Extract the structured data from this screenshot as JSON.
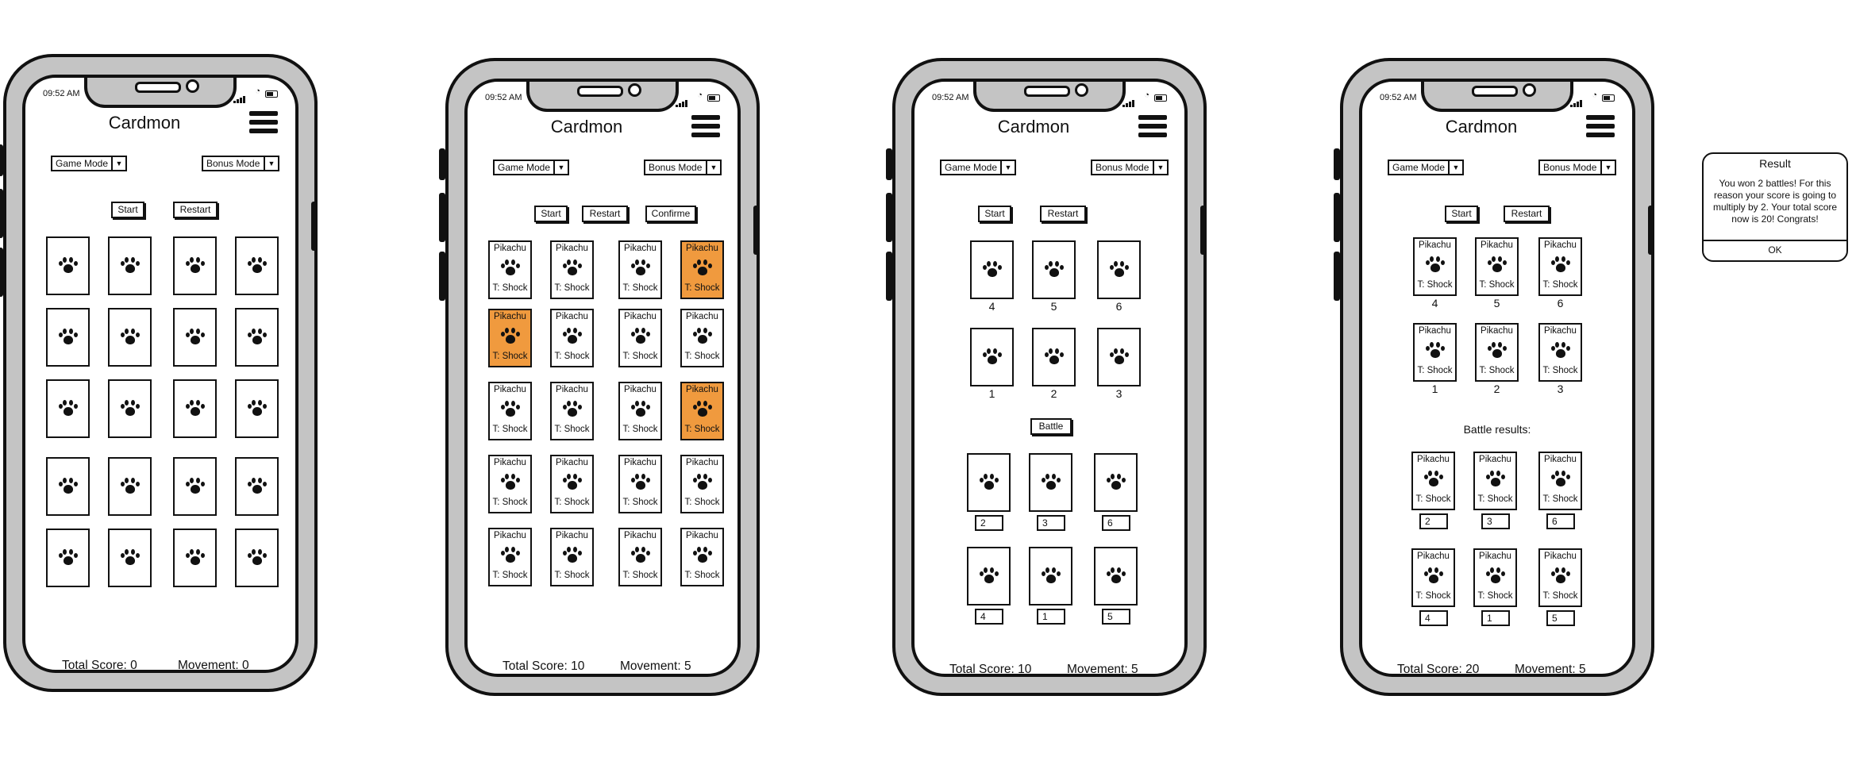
{
  "status_bar": {
    "time": "09:52 AM"
  },
  "app": {
    "title": "Cardmon",
    "game_mode": "Game Mode",
    "bonus_mode": "Bonus Mode",
    "start": "Start",
    "restart": "Restart",
    "confirm": "Confirme",
    "battle": "Battle",
    "battle_results": "Battle results:",
    "total_score_label": "Total Score:",
    "movement_label": "Movement:"
  },
  "card": {
    "name": "Pikachu",
    "type": "T: Shock"
  },
  "screens": [
    {
      "total_score": "0",
      "movement": "0"
    },
    {
      "total_score": "10",
      "movement": "5"
    },
    {
      "total_score": "10",
      "movement": "5",
      "top_numbers": [
        "4",
        "5",
        "6"
      ],
      "mid_numbers": [
        "1",
        "2",
        "3"
      ],
      "result_numbers_1": [
        "2",
        "3",
        "6"
      ],
      "result_numbers_2": [
        "4",
        "1",
        "5"
      ]
    },
    {
      "total_score": "20",
      "movement": "5",
      "top_numbers": [
        "4",
        "5",
        "6"
      ],
      "mid_numbers": [
        "1",
        "2",
        "3"
      ],
      "result_numbers_1": [
        "2",
        "3",
        "6"
      ],
      "result_numbers_2": [
        "4",
        "1",
        "5"
      ]
    }
  ],
  "dialog": {
    "title": "Result",
    "message": "You won 2 battles! For this reason your score is going to multiply by 2. Your total score now is 20! Congrats!",
    "ok": "OK"
  },
  "colors": {
    "selected_card": "#f09a3e"
  },
  "icons": [
    "paw-icon",
    "menu-icon",
    "wifi-icon",
    "battery-icon",
    "signal-icon"
  ]
}
